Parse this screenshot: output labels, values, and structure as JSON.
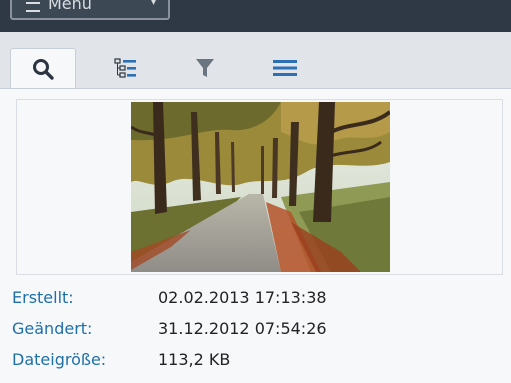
{
  "toolbar": {
    "menu_label": "Menü",
    "menu_icon": "hamburger-icon",
    "menu_chevron": "chevron-down-icon"
  },
  "tabs": [
    {
      "icon": "search-icon",
      "active": true
    },
    {
      "icon": "tree-list-icon",
      "active": false
    },
    {
      "icon": "filter-icon",
      "active": false
    },
    {
      "icon": "list-icon",
      "active": false
    }
  ],
  "preview": {
    "image": "landscape-photo-tree-lined-road-autumn"
  },
  "properties": [
    {
      "label": "Erstellt:",
      "value": "02.02.2013 17:13:38"
    },
    {
      "label": "Geändert:",
      "value": "31.12.2012 07:54:26"
    },
    {
      "label": "Dateigröße:",
      "value": "113,2 KB"
    }
  ],
  "colors": {
    "topbar": "#2f3945",
    "accent_blue": "#1f6fa8",
    "label_blue": "#1f6fa8",
    "panel_bg": "#f6f8fa"
  }
}
